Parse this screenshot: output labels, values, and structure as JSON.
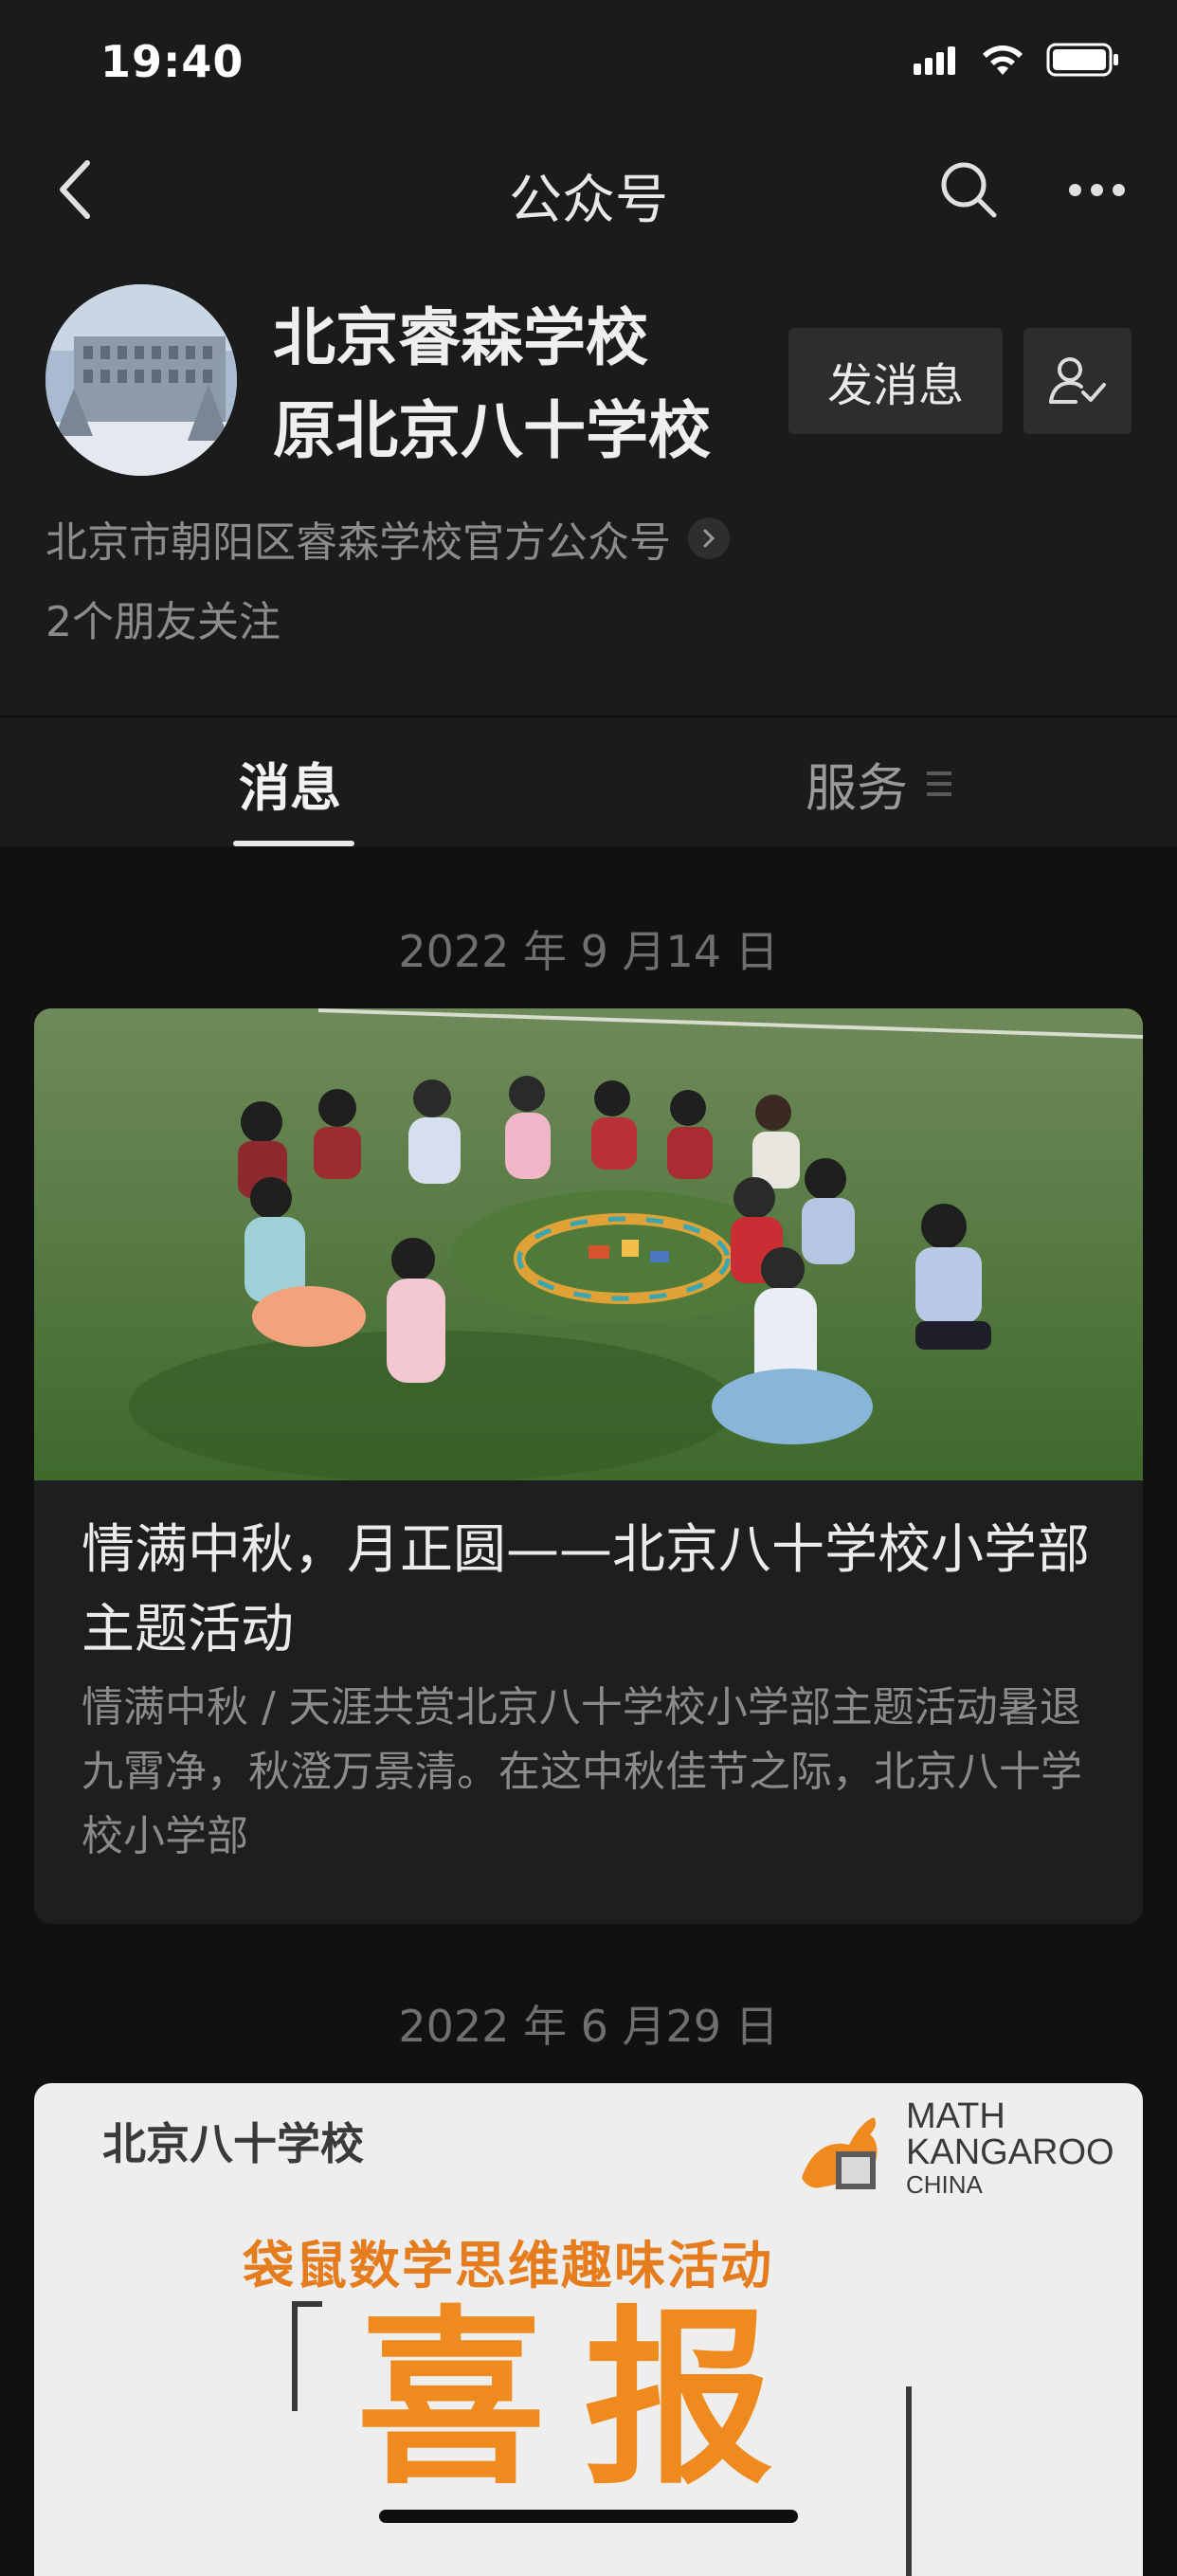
{
  "status_bar": {
    "time": "19:40"
  },
  "nav": {
    "title": "公众号"
  },
  "account": {
    "name_line1": "北京睿森学校",
    "name_line2": "原北京八十学校",
    "send_message_label": "发消息",
    "description": "北京市朝阳区睿森学校官方公众号",
    "friends_following": "2个朋友关注"
  },
  "tabs": {
    "messages": "消息",
    "services": "服务"
  },
  "feed": [
    {
      "date": "2022 年 9 月14 日",
      "title": "情满中秋，月正圆——北京八十学校小学部主题活动",
      "summary": "情满中秋 / 天涯共赏北京八十学校小学部主题活动暑退九霄净，秋澄万景清。在这中秋佳节之际，北京八十学校小学部"
    },
    {
      "date": "2022 年 6 月29 日",
      "poster": {
        "school": "北京八十学校",
        "logo_line1": "MATH",
        "logo_line2": "KANGAROO",
        "logo_line3": "CHINA",
        "subtitle": "袋鼠数学思维趣味活动",
        "headline": "喜报"
      }
    }
  ],
  "colors": {
    "background": "#111111",
    "header_bg": "#1b1b1b",
    "card_bg": "#1e1e1e",
    "poster_orange": "#ef8a1f"
  }
}
